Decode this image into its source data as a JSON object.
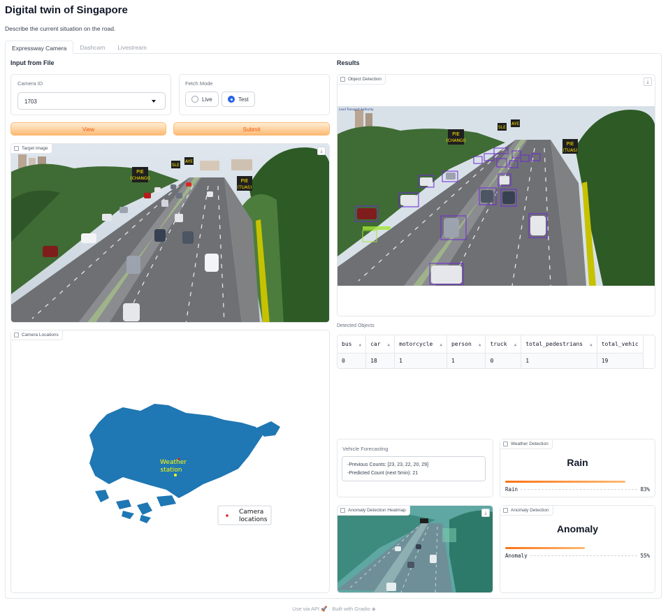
{
  "app": {
    "title": "Digital twin of Singapore",
    "subtitle": "Describe the current situation on the road."
  },
  "tabs": [
    {
      "label": "Expressway Camera",
      "active": true
    },
    {
      "label": "Dashcam",
      "active": false
    },
    {
      "label": "Livestream",
      "active": false
    }
  ],
  "input": {
    "section_title": "Input from File",
    "camera_id": {
      "label": "Camera ID",
      "value": "1703"
    },
    "fetch_mode": {
      "label": "Fetch Mode",
      "options": [
        "Live",
        "Test"
      ],
      "selected": "Test"
    },
    "view_button": "View",
    "submit_button": "Submit",
    "target_image_label": "Target image",
    "camera_locations_label": "Camera Locations",
    "map": {
      "weather_label_1": "Weather",
      "weather_label_2": "station",
      "legend_line1": "Camera",
      "legend_line2": "locations",
      "land_color": "#1f77b4"
    }
  },
  "road_signs": {
    "pie_changi_1": "PIE",
    "pie_changi_2": "(CHANGI)",
    "sle": "SLE",
    "aye": "AYE",
    "pie_tuas_1": "PIE",
    "pie_tuas_2": "(TUAS)",
    "logo_text": "Land Transport Authority"
  },
  "results": {
    "section_title": "Results",
    "object_detection_label": "Object Detection",
    "detected_objects_label": "Detected Objects",
    "table": {
      "headers": [
        "bus",
        "car",
        "motorcycle",
        "person",
        "truck",
        "total_pedestrians",
        "total_vehic"
      ],
      "rows": [
        [
          "0",
          "18",
          "1",
          "1",
          "0",
          "1",
          "19"
        ]
      ]
    },
    "forecast": {
      "label": "Vehicle Forecasting",
      "previous": "-Previous Counts: [23, 23, 22, 20, 29]",
      "predicted": "-Predicted Count (next 5min): 21"
    },
    "weather": {
      "label": "Weather Detection",
      "result": "Rain",
      "confidence_label": "Rain",
      "confidence_text": "83%",
      "confidence": 0.83
    },
    "heatmap_label": "Anomaly Detection Heatmap",
    "anomaly": {
      "label": "Anomaly Detection",
      "result": "Anomaly",
      "confidence_label": "Anomaly",
      "confidence_text": "55%",
      "confidence": 0.55
    }
  },
  "footer": {
    "api": "Use via API",
    "sep": "·",
    "built": "Built with Gradio"
  },
  "colors": {
    "accent_orange": "#f97316",
    "radio_blue": "#2563eb",
    "bbox_purple": "#6d28d9"
  }
}
